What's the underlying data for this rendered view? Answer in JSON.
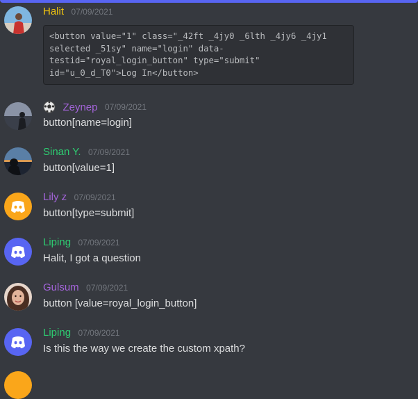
{
  "topbar": {
    "label": ""
  },
  "colors": {
    "background": "#36393f",
    "blurple": "#5865f2",
    "yellow_user": "#f1c40f",
    "purple_user": "#9b59b6",
    "green_user": "#2ecc71",
    "orange_avatar": "#faa61a"
  },
  "messages": [
    {
      "author": "Halit",
      "timestamp": "07/09/2021",
      "code": "<button value=\"1\" class=\"_42ft _4jy0 _6lth _4jy6 _4jy1\nselected _51sy\" name=\"login\" data-\ntestid=\"royal_login_button\" type=\"submit\"\nid=\"u_0_d_T0\">Log In</button>",
      "avatar_icon": "profile-photo-icon"
    },
    {
      "author": "Zeynep",
      "timestamp": "07/09/2021",
      "text": "button[name=login]",
      "avatar_icon": "profile-photo-icon",
      "badge_icon": "soccer-ball-icon"
    },
    {
      "author": "Sinan Y.",
      "timestamp": "07/09/2021",
      "text": "button[value=1]",
      "avatar_icon": "profile-photo-icon"
    },
    {
      "author": "Lily z",
      "timestamp": "07/09/2021",
      "text": "button[type=submit]",
      "avatar_icon": "discord-logo-icon"
    },
    {
      "author": "Liping",
      "timestamp": "07/09/2021",
      "text": "Halit, I got a question",
      "avatar_icon": "discord-logo-icon"
    },
    {
      "author": "Gulsum",
      "timestamp": "07/09/2021",
      "text": "button [value=royal_login_button]",
      "avatar_icon": "profile-photo-icon"
    },
    {
      "author": "Liping",
      "timestamp": "07/09/2021",
      "text": "Is this the way we create the custom xpath?",
      "avatar_icon": "discord-logo-icon"
    }
  ]
}
